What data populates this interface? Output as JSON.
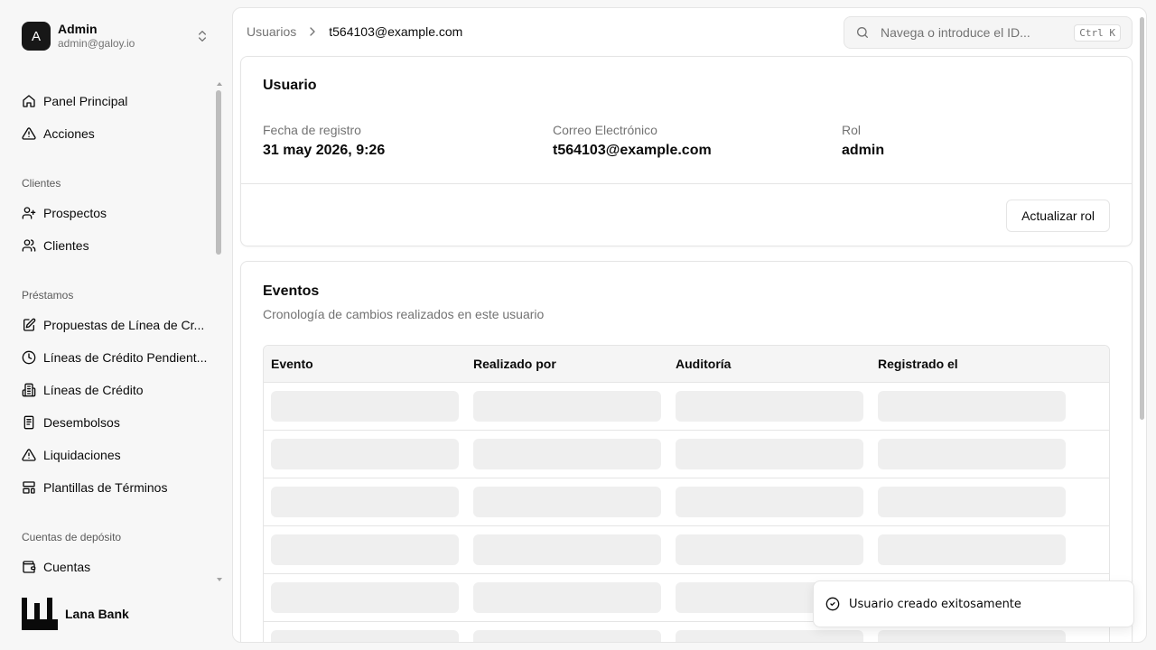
{
  "user": {
    "avatar_initial": "A",
    "name": "Admin",
    "email": "admin@galoy.io"
  },
  "sidebar": {
    "items": [
      {
        "label": "Panel Principal",
        "icon": "home-icon"
      },
      {
        "label": "Acciones",
        "icon": "alert-triangle-icon"
      }
    ],
    "groups": [
      {
        "label": "Clientes",
        "items": [
          {
            "label": "Prospectos",
            "icon": "user-plus-icon"
          },
          {
            "label": "Clientes",
            "icon": "users-icon"
          }
        ]
      },
      {
        "label": "Préstamos",
        "items": [
          {
            "label": "Propuestas de Línea de Cr...",
            "icon": "file-edit-icon"
          },
          {
            "label": "Líneas de Crédito Pendient...",
            "icon": "clock-icon"
          },
          {
            "label": "Líneas de Crédito",
            "icon": "building-icon"
          },
          {
            "label": "Desembolsos",
            "icon": "receipt-icon"
          },
          {
            "label": "Liquidaciones",
            "icon": "alert-triangle-icon"
          },
          {
            "label": "Plantillas de Términos",
            "icon": "layout-template-icon"
          }
        ]
      },
      {
        "label": "Cuentas de depósito",
        "items": [
          {
            "label": "Cuentas",
            "icon": "wallet-icon"
          }
        ]
      }
    ]
  },
  "brand": {
    "name": "Lana Bank"
  },
  "breadcrumb": {
    "parent": "Usuarios",
    "current": "t564103@example.com"
  },
  "search": {
    "placeholder": "Navega o introduce el ID...",
    "shortcut": "Ctrl K"
  },
  "user_card": {
    "title": "Usuario",
    "fields": [
      {
        "label": "Fecha de registro",
        "value": "31 may 2026, 9:26"
      },
      {
        "label": "Correo Electrónico",
        "value": "t564103@example.com"
      },
      {
        "label": "Rol",
        "value": "admin"
      }
    ],
    "action_label": "Actualizar rol"
  },
  "events_card": {
    "title": "Eventos",
    "description": "Cronología de cambios realizados en este usuario",
    "columns": [
      "Evento",
      "Realizado por",
      "Auditoría",
      "Registrado el"
    ],
    "loading_rows": 6
  },
  "toast": {
    "message": "Usuario creado exitosamente"
  },
  "colors": {
    "background": "#f7f7f7",
    "surface": "#ffffff",
    "border": "#e5e5e5",
    "muted_text": "#737373",
    "skeleton": "#efefef",
    "avatar_bg": "#171717"
  }
}
